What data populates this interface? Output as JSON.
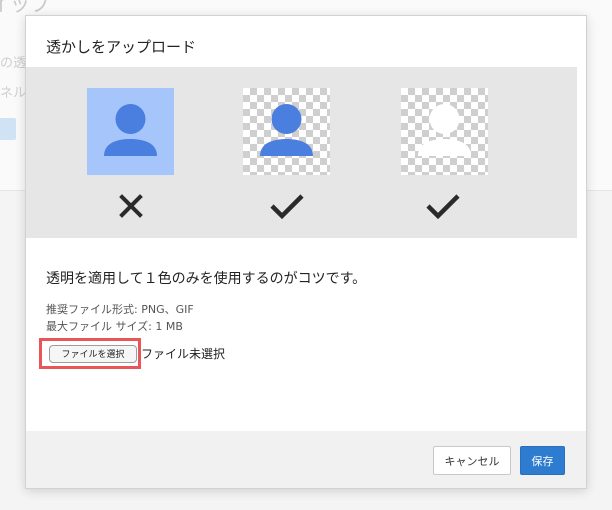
{
  "background": {
    "title_fragment": "イップ",
    "line1_fragment": "の透",
    "line2_fragment": "ネル"
  },
  "dialog": {
    "title": "透かしをアップロード",
    "samples": [
      {
        "style": "opaque-background",
        "verdict": "x-icon"
      },
      {
        "style": "transparent-colored",
        "verdict": "check-icon"
      },
      {
        "style": "transparent-white",
        "verdict": "check-icon"
      }
    ],
    "tip": "透明を適用して１色のみを使用するのがコツです。",
    "recommended_formats": "推奨ファイル形式: PNG、GIF",
    "max_size": "最大ファイル サイズ: 1 MB",
    "file_button_label": "ファイルを選択",
    "file_status": "ファイル未選択",
    "cancel_label": "キャンセル",
    "save_label": "保存"
  },
  "colors": {
    "accent_blue": "#2d7cd0",
    "avatar_blue": "#4a7fe0",
    "sample_bg_blue": "#a6c6fb",
    "highlight_red": "#e8565a"
  }
}
